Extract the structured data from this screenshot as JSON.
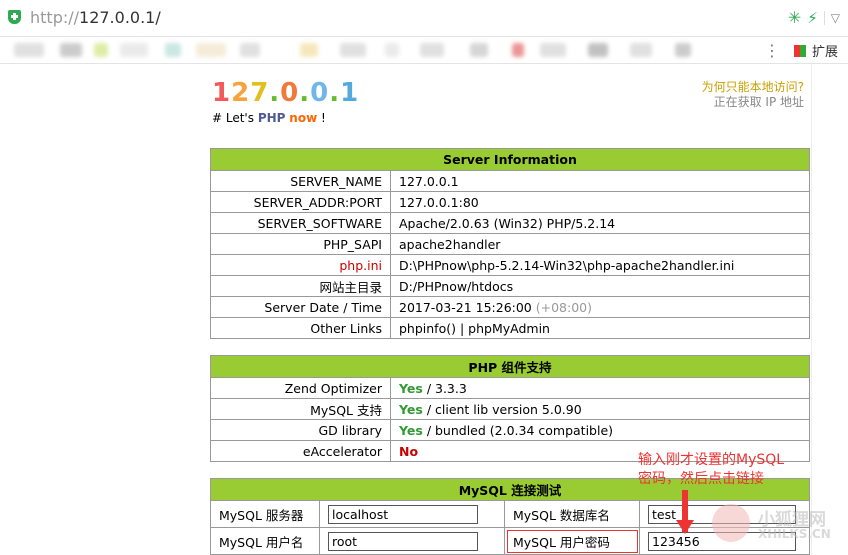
{
  "browser": {
    "url_proto": "http://",
    "url_host": "127.0.0.1/",
    "ext_label": "扩展"
  },
  "header": {
    "logo_chars": [
      {
        "ch": "1",
        "color": "#f05a5a"
      },
      {
        "ch": "2",
        "color": "#f7a33c"
      },
      {
        "ch": "7",
        "color": "#e0c020"
      },
      {
        "ch": ".",
        "color": "#66bb33"
      },
      {
        "ch": "0",
        "color": "#ef7a3a"
      },
      {
        "ch": ".",
        "color": "#66bb33"
      },
      {
        "ch": "0",
        "color": "#6fb6ea"
      },
      {
        "ch": ".",
        "color": "#66bb33"
      },
      {
        "ch": "1",
        "color": "#55aadd"
      }
    ],
    "tag_prefix": "# Let's",
    "tag_php": "PHP",
    "tag_now": "now",
    "tag_suffix": "!",
    "why_local": "为何只能本地访问?",
    "getting_ip": "正在获取 IP 地址"
  },
  "server": {
    "title": "Server Information",
    "rows": [
      {
        "k": "SERVER_NAME",
        "v": "127.0.0.1"
      },
      {
        "k": "SERVER_ADDR:PORT",
        "v": "127.0.0.1:80"
      },
      {
        "k": "SERVER_SOFTWARE",
        "v": "Apache/2.0.63 (Win32) PHP/5.2.14"
      },
      {
        "k": "PHP_SAPI",
        "v": "apache2handler"
      },
      {
        "k": "php.ini",
        "v": "D:\\PHPnow\\php-5.2.14-Win32\\php-apache2handler.ini"
      },
      {
        "k": "网站主目录",
        "v": "D:/PHPnow/htdocs"
      },
      {
        "k": "Server Date / Time",
        "v": "2017-03-21 15:26:00",
        "extra": "(+08:00)"
      },
      {
        "k": "Other Links",
        "v": "phpinfo() | phpMyAdmin"
      }
    ]
  },
  "php": {
    "title": "PHP 组件支持",
    "rows": [
      {
        "k": "Zend Optimizer",
        "status": "Yes",
        "v": "/ 3.3.3"
      },
      {
        "k": "MySQL 支持",
        "status": "Yes",
        "v": "/ client lib version 5.0.90"
      },
      {
        "k": "GD library",
        "status": "Yes",
        "v": "/ bundled (2.0.34 compatible)"
      },
      {
        "k": "eAccelerator",
        "status": "No",
        "v": ""
      }
    ]
  },
  "mysql": {
    "title": "MySQL 连接测试",
    "server_label": "MySQL 服务器",
    "server_value": "localhost",
    "db_label": "MySQL 数据库名",
    "db_value": "test",
    "user_label": "MySQL 用户名",
    "user_value": "root",
    "pass_label": "MySQL 用户密码",
    "pass_value": "123456"
  },
  "annotation": {
    "line1": "输入刚才设置的MySQL",
    "line2": "密码，然后点击链接"
  },
  "watermark": {
    "text": "小狐狸网",
    "url": "XHILKS.CN"
  }
}
